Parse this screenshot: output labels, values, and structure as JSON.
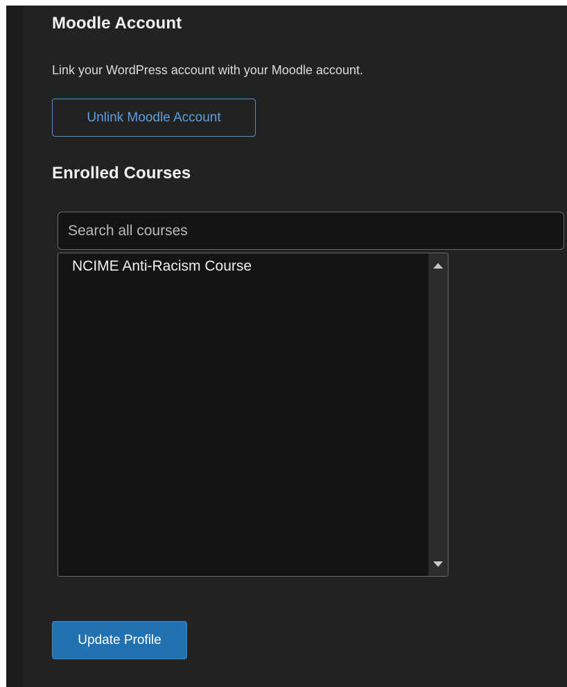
{
  "moodle_account": {
    "heading": "Moodle Account",
    "description": "Link your WordPress account with your Moodle account.",
    "unlink_button": "Unlink Moodle Account"
  },
  "enrolled_courses": {
    "heading": "Enrolled Courses",
    "search_placeholder": "Search all courses",
    "courses": [
      "NCIME Anti-Racism Course"
    ]
  },
  "update_button": "Update Profile",
  "colors": {
    "panel_bg": "#222222",
    "field_bg": "#141414",
    "link_blue": "#5aa0e6",
    "primary_blue": "#2271b1"
  },
  "icons": [
    "scroll-up-arrow-icon",
    "scroll-down-arrow-icon"
  ]
}
